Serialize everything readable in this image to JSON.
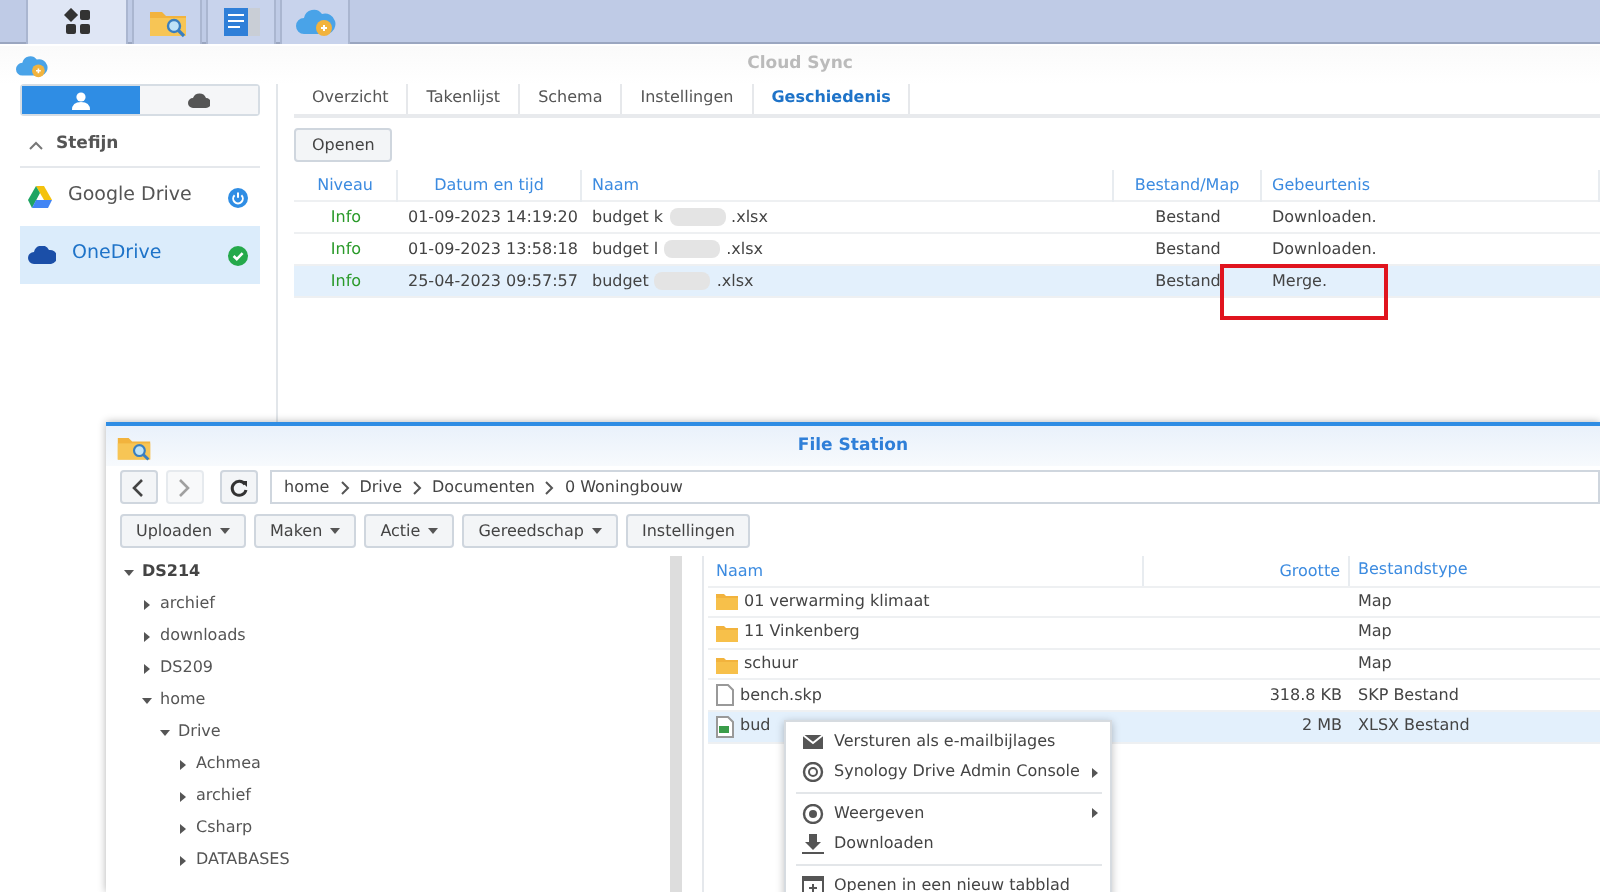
{
  "taskbar": {
    "items": [
      {
        "kind": "apps",
        "selected": true
      },
      {
        "kind": "file-station",
        "selected": false
      },
      {
        "kind": "panel",
        "selected": false
      },
      {
        "kind": "cloud-sync",
        "selected": false
      }
    ]
  },
  "cloud_sync": {
    "title": "Cloud Sync",
    "account_toggle": [
      {
        "kind": "user",
        "selected": true
      },
      {
        "kind": "cloud",
        "selected": false
      }
    ],
    "user": {
      "name": "Stefijn",
      "expanded": true
    },
    "connections": [
      {
        "name": "Google Drive",
        "kind": "google-drive",
        "synced": false,
        "selected": false
      },
      {
        "name": "OneDrive",
        "kind": "onedrive",
        "synced": true,
        "selected": true
      }
    ],
    "tabs": [
      {
        "label": "Overzicht",
        "selected": false
      },
      {
        "label": "Takenlijst",
        "selected": false
      },
      {
        "label": "Schema",
        "selected": false
      },
      {
        "label": "Instellingen",
        "selected": false
      },
      {
        "label": "Geschiedenis",
        "selected": true
      }
    ],
    "open_button": "Openen",
    "columns": [
      "Niveau",
      "Datum en tijd",
      "Naam",
      "Bestand/Map",
      "Gebeurtenis"
    ],
    "rows": [
      {
        "severity": "Info",
        "datetime": "01-09-2023 14:19:20",
        "name_start": "budget k",
        "name_end": ".xlsx",
        "type": "Bestand",
        "event": "Downloaden.",
        "selected": false,
        "marked": false
      },
      {
        "severity": "Info",
        "datetime": "01-09-2023 13:58:18",
        "name_start": "budget l",
        "name_end": ".xlsx",
        "type": "Bestand",
        "event": "Downloaden.",
        "selected": false,
        "marked": false
      },
      {
        "severity": "Info",
        "datetime": "25-04-2023 09:57:57",
        "name_start": "budget",
        "name_end": ".xlsx",
        "type": "Bestand",
        "event": "Merge.",
        "selected": true,
        "marked": true
      }
    ]
  },
  "file_station": {
    "title": "File Station",
    "nav": [
      {
        "kind": "back",
        "disabled": false
      },
      {
        "kind": "forward",
        "disabled": true
      },
      {
        "kind": "refresh",
        "disabled": false
      }
    ],
    "path": [
      "home",
      "Drive",
      "Documenten",
      "0 Woningbouw"
    ],
    "toolbar": [
      {
        "label": "Uploaden",
        "dropdown": true
      },
      {
        "label": "Maken",
        "dropdown": true
      },
      {
        "label": "Actie",
        "dropdown": true
      },
      {
        "label": "Gereedschap",
        "dropdown": true
      },
      {
        "label": "Instellingen",
        "dropdown": false
      }
    ],
    "tree": [
      {
        "label": "DS214",
        "expanded": true,
        "children": [
          {
            "label": "archief",
            "expanded": false
          },
          {
            "label": "downloads",
            "expanded": false
          },
          {
            "label": "DS209",
            "expanded": false
          },
          {
            "label": "home",
            "expanded": true,
            "children": [
              {
                "label": "Drive",
                "expanded": true,
                "children": [
                  {
                    "label": "Achmea",
                    "expanded": false
                  },
                  {
                    "label": "archief",
                    "expanded": false
                  },
                  {
                    "label": "Csharp",
                    "expanded": false
                  },
                  {
                    "label": "DATABASES",
                    "expanded": false
                  }
                ]
              }
            ]
          }
        ]
      }
    ],
    "columns": [
      "Naam",
      "Grootte",
      "Bestandstype"
    ],
    "files": [
      {
        "kind": "folder",
        "name": "01 verwarming klimaat",
        "type": "Map",
        "selected": false
      },
      {
        "kind": "folder",
        "name": "11 Vinkenberg",
        "type": "Map",
        "selected": false
      },
      {
        "kind": "folder",
        "name": "schuur",
        "type": "Map",
        "selected": false
      },
      {
        "kind": "file",
        "name": "bench.skp",
        "size": "318.8 KB",
        "type": "SKP Bestand",
        "selected": false
      },
      {
        "kind": "spreadsheet",
        "name": "bud",
        "size": "2 MB",
        "type": "XLSX Bestand",
        "selected": true
      }
    ],
    "context_menu": [
      {
        "kind": "mail",
        "label": "Versturen als e-mailbijlages",
        "submenu": false
      },
      {
        "kind": "drive",
        "label": "Synology Drive Admin Console",
        "submenu": true
      },
      {
        "kind": "separator"
      },
      {
        "kind": "view",
        "label": "Weergeven",
        "submenu": true
      },
      {
        "kind": "download",
        "label": "Downloaden",
        "submenu": false
      },
      {
        "kind": "separator"
      },
      {
        "kind": "newtab",
        "label": "Openen in een nieuw tabblad",
        "submenu": false
      }
    ]
  }
}
